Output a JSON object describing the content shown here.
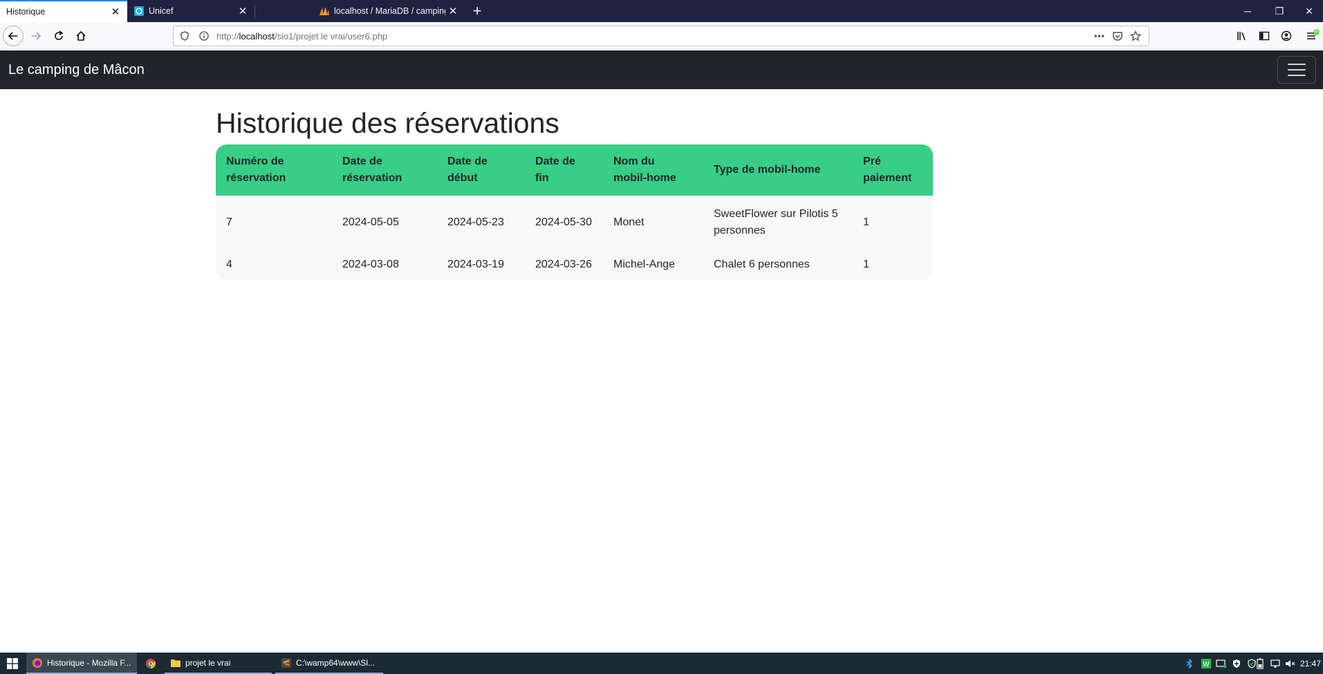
{
  "browser": {
    "tabs": [
      {
        "title": "Historique",
        "close": "✕"
      },
      {
        "title": "Unicef",
        "close": "✕"
      },
      {
        "title": "localhost / MariaDB / camping",
        "close": "✕"
      }
    ],
    "new_tab": "+",
    "window_buttons": {
      "minimize": "─",
      "restore": "❐",
      "close": "✕"
    },
    "url": {
      "scheme": "http://",
      "host": "localhost",
      "path": "/sio1/projet le vrai/user6.php"
    },
    "url_menu": "•••"
  },
  "site": {
    "brand": "Le camping de Mâcon",
    "page_title": "Historique des réservations",
    "table": {
      "headers": [
        [
          "Numéro de",
          "réservation"
        ],
        [
          "Date de",
          "réservation"
        ],
        [
          "Date de",
          "début"
        ],
        [
          "Date de",
          "fin"
        ],
        [
          "Nom du",
          "mobil-home"
        ],
        [
          "Type de mobil-home"
        ],
        [
          "Pré",
          "paiement"
        ]
      ],
      "rows": [
        {
          "numero": "7",
          "date_reservation": "2024-05-05",
          "date_debut": "2024-05-23",
          "date_fin": "2024-05-30",
          "nom": "Monet",
          "type_line1": "SweetFlower sur Pilotis 5",
          "type_line2": "personnes",
          "prepaiement": "1"
        },
        {
          "numero": "4",
          "date_reservation": "2024-03-08",
          "date_debut": "2024-03-19",
          "date_fin": "2024-03-26",
          "nom": "Michel-Ange",
          "type_line1": "Chalet 6 personnes",
          "type_line2": "",
          "prepaiement": "1"
        }
      ]
    }
  },
  "taskbar": {
    "items": [
      {
        "label": "Historique - Mozilla F..."
      },
      {
        "label": "projet le vrai"
      },
      {
        "label": "C:\\wamp64\\www\\Sl..."
      }
    ],
    "clock": "21:47"
  },
  "colors": {
    "accent_header": "#38ce86",
    "site_navbar": "#212529",
    "tab_strip": "#202340",
    "taskbar": "#1c2a33"
  }
}
